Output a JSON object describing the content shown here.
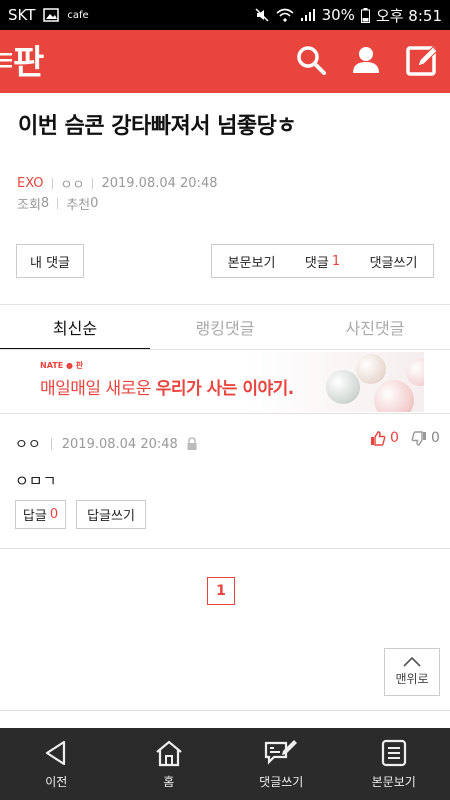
{
  "statusbar": {
    "carrier": "SKT",
    "cafe": "cafe",
    "battery": "30%",
    "time": "오후 8:51"
  },
  "post": {
    "title": "이번 슴콘 강타빠져서 넘좋당ㅎ",
    "category": "EXO",
    "author": "ㅇㅇ",
    "datetime": "2019.08.04 20:48",
    "views_label": "조회",
    "views": "8",
    "likes_label": "추천",
    "likes": "0"
  },
  "actions": {
    "my_comments": "내 댓글",
    "view_post": "본문보기",
    "comments_label": "댓글",
    "comments_count": "1",
    "write_comment": "댓글쓰기"
  },
  "tabs": {
    "latest": "최신순",
    "ranking": "랭킹댓글",
    "photo": "사진댓글"
  },
  "banner": {
    "brand": "NATE ● 판",
    "text_plain": "매일매일 새로운 ",
    "text_bold": "우리가 사는 이야기."
  },
  "comment": {
    "author": "ㅇㅇ",
    "datetime": "2019.08.04 20:48",
    "up": "0",
    "down": "0",
    "body": "ㅇㅁㄱ",
    "reply_label": "답글",
    "reply_count": "0",
    "reply_write": "답글쓰기"
  },
  "pager": {
    "current": "1"
  },
  "top_button": "맨위로",
  "bottomnav": {
    "prev": "이전",
    "home": "홈",
    "write": "댓글쓰기",
    "view": "본문보기"
  },
  "colors": {
    "brand": "#e9453f",
    "navbar": "#2b2b2b"
  }
}
